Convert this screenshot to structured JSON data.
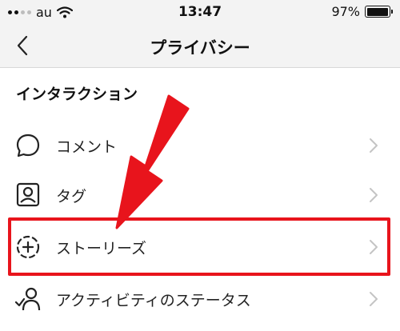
{
  "status_bar": {
    "carrier": "au",
    "time": "13:47",
    "battery": "97%",
    "battery_level": 0.97
  },
  "nav": {
    "title": "プライバシー"
  },
  "section": {
    "header": "インタラクション"
  },
  "items": [
    {
      "label": "コメント",
      "icon": "comment-icon"
    },
    {
      "label": "タグ",
      "icon": "tag-icon"
    },
    {
      "label": "ストーリーズ",
      "icon": "story-add-icon"
    },
    {
      "label": "アクティビティのステータス",
      "icon": "activity-status-icon"
    }
  ],
  "colors": {
    "highlight": "#e8141c",
    "bar_background": "#f3f3f3",
    "chevron": "#c4c4c4"
  }
}
